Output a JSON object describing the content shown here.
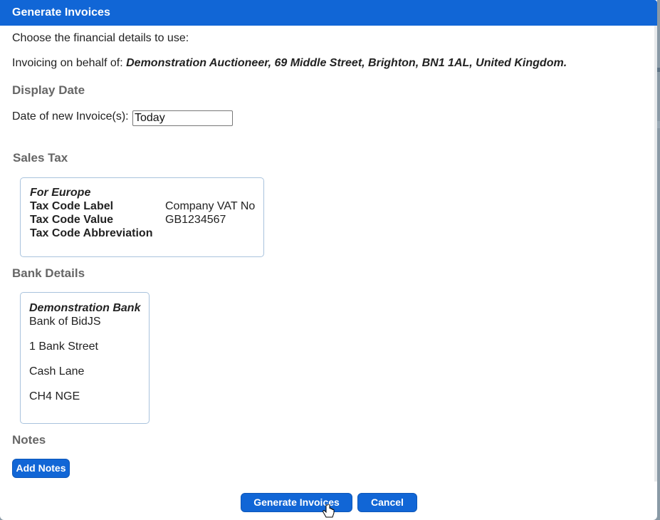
{
  "dialog": {
    "title": "Generate Invoices",
    "intro": "Choose the financial details to use:",
    "behalf_prefix": "Invoicing on behalf of:",
    "behalf_value": "Demonstration Auctioneer, 69 Middle Street, Brighton, BN1 1AL, United Kingdom."
  },
  "display_date": {
    "heading": "Display Date",
    "label": "Date of new Invoice(s):",
    "value": "Today"
  },
  "sales_tax": {
    "heading": "Sales Tax",
    "region": "For Europe",
    "rows": [
      {
        "label": "Tax Code Label",
        "value": "Company VAT No"
      },
      {
        "label": "Tax Code Value",
        "value": "GB1234567"
      },
      {
        "label": "Tax Code Abbreviation",
        "value": ""
      }
    ]
  },
  "bank": {
    "heading": "Bank Details",
    "name": "Demonstration Bank",
    "lines": [
      "Bank of BidJS",
      "1 Bank Street",
      "Cash Lane",
      "CH4 NGE"
    ]
  },
  "notes": {
    "heading": "Notes",
    "add_label": "Add Notes"
  },
  "footer": {
    "generate_label": "Generate Invoices",
    "cancel_label": "Cancel"
  },
  "colors": {
    "primary": "#1166d6",
    "box_border": "#a9c3dd",
    "heading": "#666666"
  }
}
